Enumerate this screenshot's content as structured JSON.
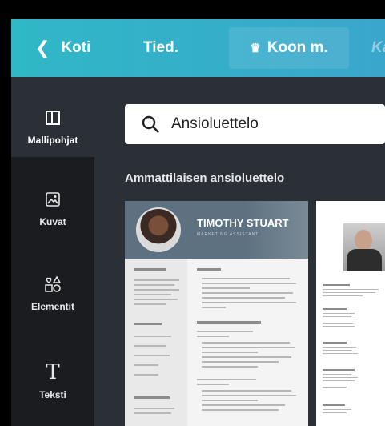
{
  "topbar": {
    "back_label": "Koti",
    "tab_file": "Tied.",
    "tab_resize": "Koon m.",
    "tab_faded": "Ka",
    "accent_color": "#2fb8c6"
  },
  "sidebar": {
    "items": [
      {
        "label": "Mallipohjat",
        "icon": "templates-icon"
      },
      {
        "label": "Kuvat",
        "icon": "image-icon"
      },
      {
        "label": "Elementit",
        "icon": "shapes-icon"
      },
      {
        "label": "Teksti",
        "icon": "text-icon"
      }
    ]
  },
  "search": {
    "value": "Ansioluettelo"
  },
  "section": {
    "title": "Ammattilaisen ansioluettelo"
  },
  "templates": [
    {
      "name": "TIMOTHY STUART",
      "role": "MARKETING ASSISTANT"
    },
    {
      "name": "",
      "role": ""
    }
  ]
}
